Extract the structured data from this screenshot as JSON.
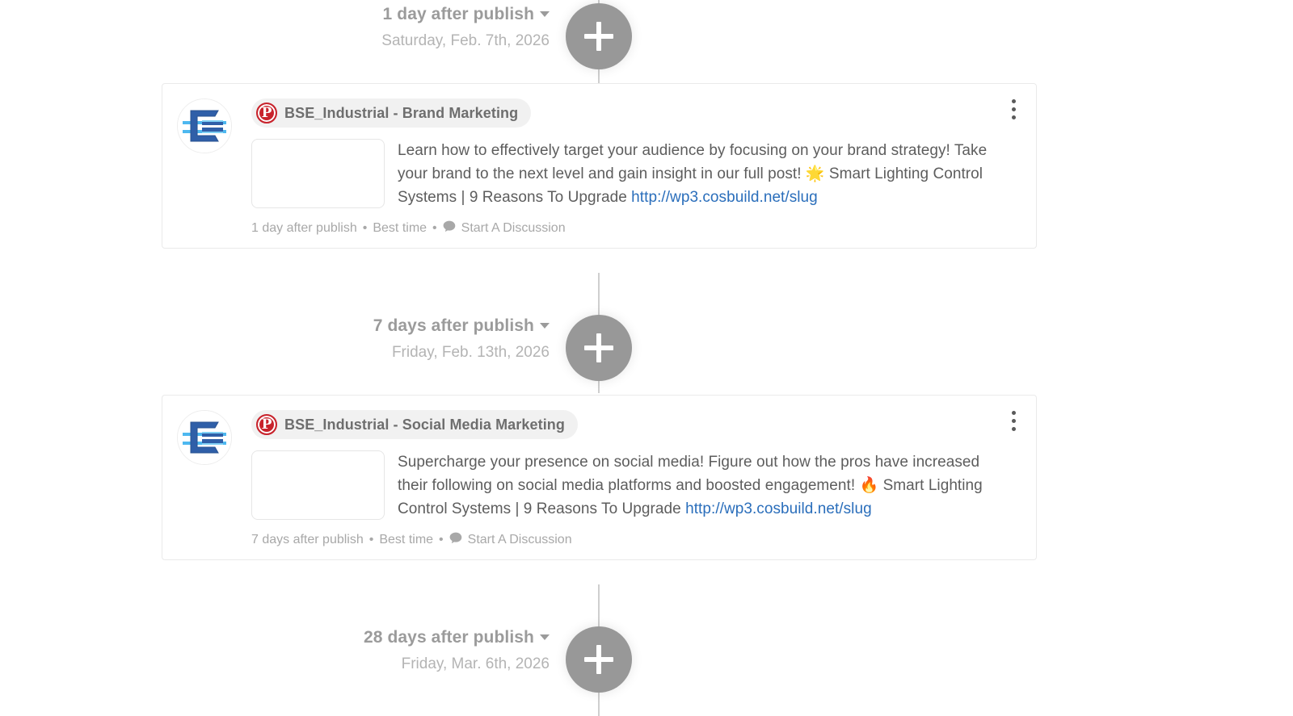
{
  "theme": {
    "accent_link": "#2a6ebb",
    "pinterest_red": "#c8232c",
    "muted_text": "#9b9b9b",
    "plus_button_gray": "#989898",
    "card_border": "#eaeaea"
  },
  "timeline": {
    "slots": [
      {
        "label": "1 day after publish",
        "date": "Saturday, Feb. 7th, 2026",
        "add_button_icon": "plus-icon"
      },
      {
        "label": "7 days after publish",
        "date": "Friday, Feb. 13th, 2026",
        "add_button_icon": "plus-icon"
      },
      {
        "label": "28 days after publish",
        "date": "Friday, Mar. 6th, 2026",
        "add_button_icon": "plus-icon"
      }
    ],
    "posts": [
      {
        "network_icon": "pinterest-icon",
        "network_glyph": "P",
        "account_name": "BSE_Industrial - Brand Marketing",
        "avatar_icon": "bse-industrial-logo-avatar",
        "media_placeholder": "empty-image-placeholder",
        "text_before_link": "Learn how to effectively target your audience by focusing on your brand strategy! Take your brand to the next level and gain insight in our full post! 🌟  Smart Lighting Control Systems | 9 Reasons To Upgrade ",
        "link_text": "http://wp3.cosbuild.net/slug",
        "footer": {
          "schedule": "1 day after publish",
          "separator": "•",
          "timing": "Best time",
          "discussion_icon": "chat-bubble-icon",
          "discussion_label": "Start A Discussion"
        },
        "menu_icon": "kebab-menu-icon"
      },
      {
        "network_icon": "pinterest-icon",
        "network_glyph": "P",
        "account_name": "BSE_Industrial - Social Media Marketing",
        "avatar_icon": "bse-industrial-logo-avatar",
        "media_placeholder": "empty-image-placeholder",
        "text_before_link": "Supercharge your presence on social media! Figure out how the pros have increased their following on social media platforms and boosted engagement! 🔥  Smart Lighting Control Systems | 9 Reasons To Upgrade ",
        "link_text": "http://wp3.cosbuild.net/slug",
        "footer": {
          "schedule": "7 days after publish",
          "separator": "•",
          "timing": "Best time",
          "discussion_icon": "chat-bubble-icon",
          "discussion_label": "Start A Discussion"
        },
        "menu_icon": "kebab-menu-icon"
      }
    ]
  }
}
